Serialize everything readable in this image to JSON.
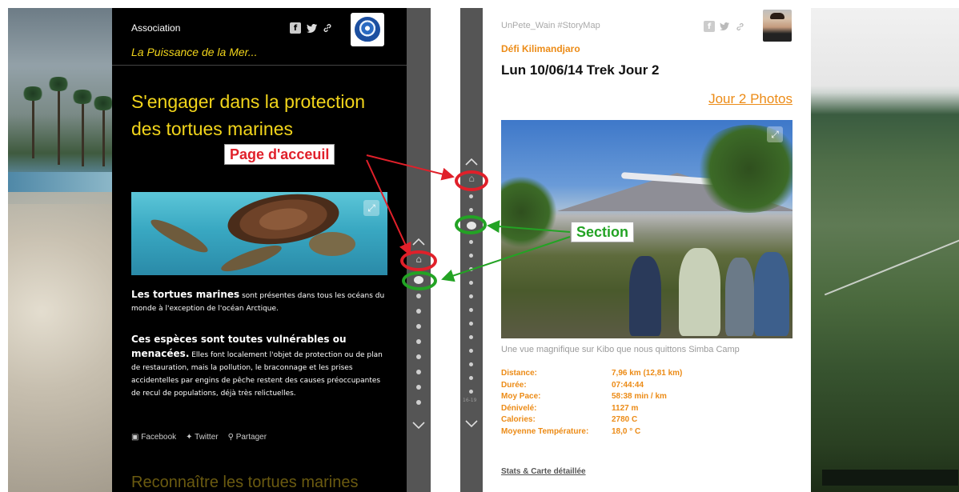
{
  "colors": {
    "accent_yellow": "#f2d51b",
    "accent_orange": "#ec8b16",
    "annotation_red": "#e0202a",
    "annotation_green": "#23a324",
    "panel_black": "#000000",
    "nav_gray": "#555555"
  },
  "left_story": {
    "org": "Association",
    "subtitle": "La Puissance de la Mer...",
    "share_icons": [
      "facebook-icon",
      "twitter-icon",
      "link-icon"
    ],
    "title": "S'engager dans la protection des tortues marines",
    "para1_bold": "Les tortues marines",
    "para1_rest": " sont présentes dans tous les océans du monde à l'exception de l'océan Arctique.",
    "para2_bold": "Ces espèces sont toutes vulnérables ou menacées.",
    "para2_rest": " Elles font localement l'objet de protection ou de plan de restauration, mais la pollution, le braconnage et les prises accidentelles par engins de pêche restent des causes préoccupantes de recul de populations, déjà très relictuelles.",
    "footer": {
      "facebook": "Facebook",
      "twitter": "Twitter",
      "share": "Partager"
    },
    "next_section": "Reconnaître les tortues marines"
  },
  "right_story": {
    "author": "UnPete_Wain #StoryMap",
    "story_title": "Défi Kilimandjaro",
    "entry_title": "Lun 10/06/14 Trek Jour 2",
    "photos_link": "Jour 2 Photos",
    "caption": "Une vue magnifique sur Kibo que nous quittons Simba Camp",
    "stats": [
      {
        "label": "Distance:",
        "value": "7,96 km (12,81 km)"
      },
      {
        "label": "Durée:",
        "value": "07:44:44"
      },
      {
        "label": "Moy Pace:",
        "value": "58:38 min / km"
      },
      {
        "label": "Dénivelé:",
        "value": "1127 m"
      },
      {
        "label": "Calories:",
        "value": "2780 C"
      },
      {
        "label": "Moyenne Température:",
        "value": "18,0 ° C"
      }
    ],
    "more_link": "Stats & Carte détaillée",
    "slide_counter": "16-19"
  },
  "annotations": {
    "home_label": "Page d'acceuil",
    "section_label": "Section"
  }
}
